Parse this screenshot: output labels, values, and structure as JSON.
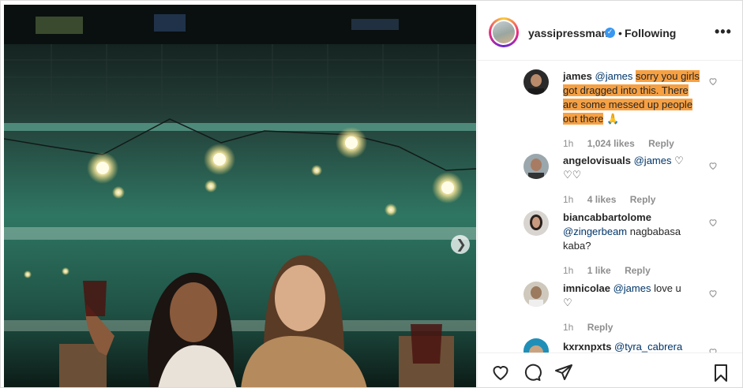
{
  "header": {
    "username": "yassipressman",
    "separator": "•",
    "follow_status": "Following",
    "more_label": "•••"
  },
  "comments": [
    {
      "user": "james",
      "mention": "@james",
      "text": "sorry you girls got dragged into this. There are some messed up people out there",
      "emoji": "🙏",
      "time": "1h",
      "likes": "1,024 likes",
      "reply": "Reply"
    },
    {
      "user": "angelovisuals",
      "mention": "@james",
      "text": "♡ ♡♡",
      "time": "1h",
      "likes": "4 likes",
      "reply": "Reply"
    },
    {
      "user": "biancabbartolome",
      "mention": "@zingerbeam",
      "text": "nagbabasa kaba?",
      "time": "1h",
      "likes": "1 like",
      "reply": "Reply"
    },
    {
      "user": "imnicolae",
      "mention": "@james",
      "text": "love u",
      "emoji": "♡",
      "time": "1h",
      "reply": "Reply"
    },
    {
      "user": "kxrxnpxts",
      "mention": "@tyra_cabrera"
    }
  ],
  "icons": [
    "heart-icon",
    "comment-icon",
    "share-icon",
    "bookmark-icon",
    "chevron-right-icon",
    "verified-icon"
  ]
}
